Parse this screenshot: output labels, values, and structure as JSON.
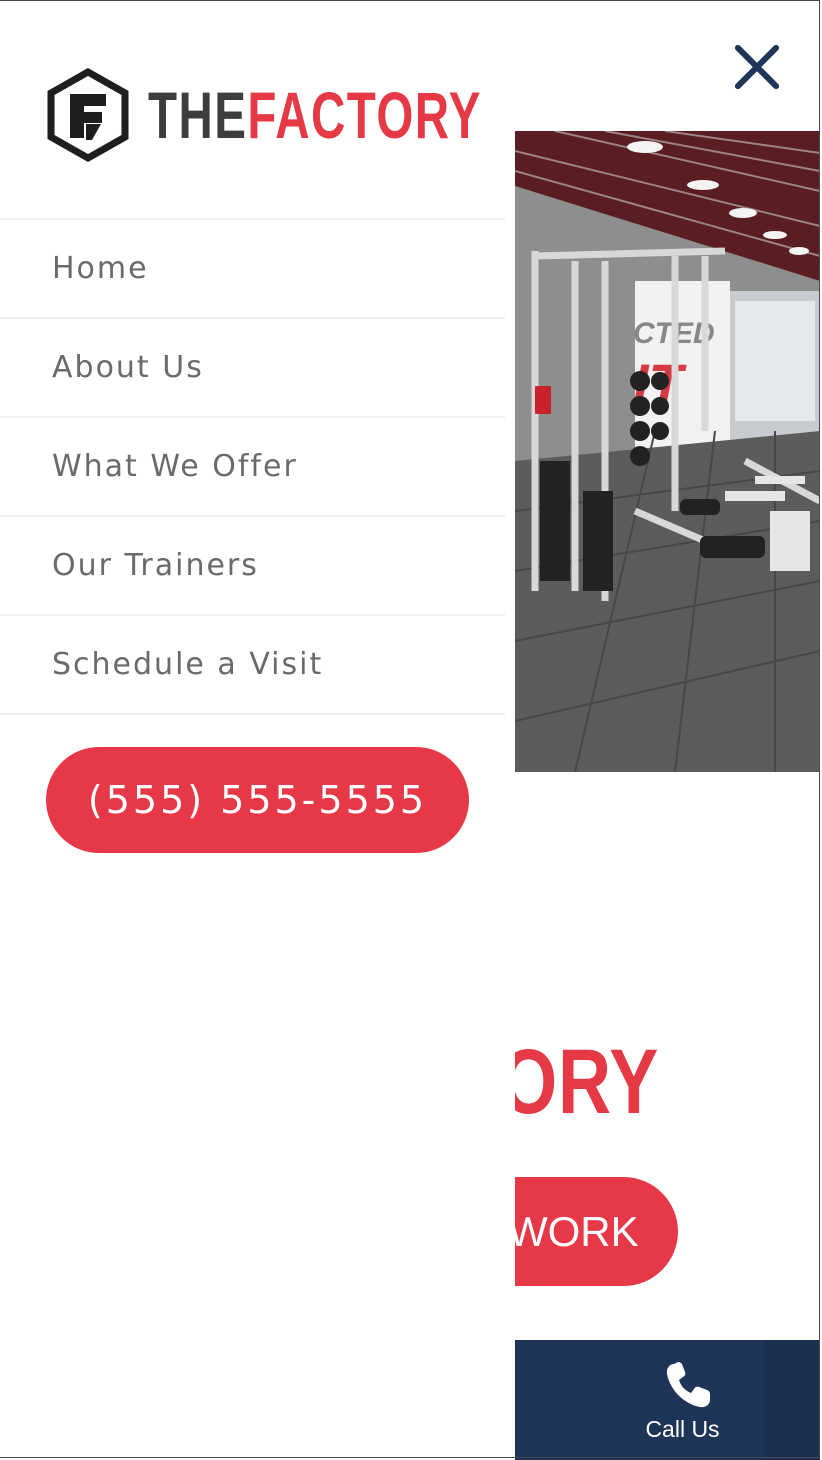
{
  "brand": {
    "logo_text_the": "THE",
    "logo_text_factory": "FACTORY"
  },
  "menu": {
    "items": [
      {
        "label": "Home"
      },
      {
        "label": "About Us"
      },
      {
        "label": "What We Offer"
      },
      {
        "label": "Our Trainers"
      },
      {
        "label": "Schedule a Visit"
      }
    ],
    "phone_label": "(555) 555-5555",
    "close_icon": "close-icon"
  },
  "background_page": {
    "hero_image": "gym-interior-photo",
    "hero_sign_text": "CTED",
    "hero_sign_text_2": "IT",
    "heading_fragment": "ORY",
    "cta_fragment": "WORK",
    "call_label": "Call Us",
    "call_icon": "phone-icon"
  },
  "colors": {
    "accent": "#e73848",
    "navy": "#1f3557",
    "menu_text": "#6a6a6a",
    "divider": "#efefef"
  }
}
